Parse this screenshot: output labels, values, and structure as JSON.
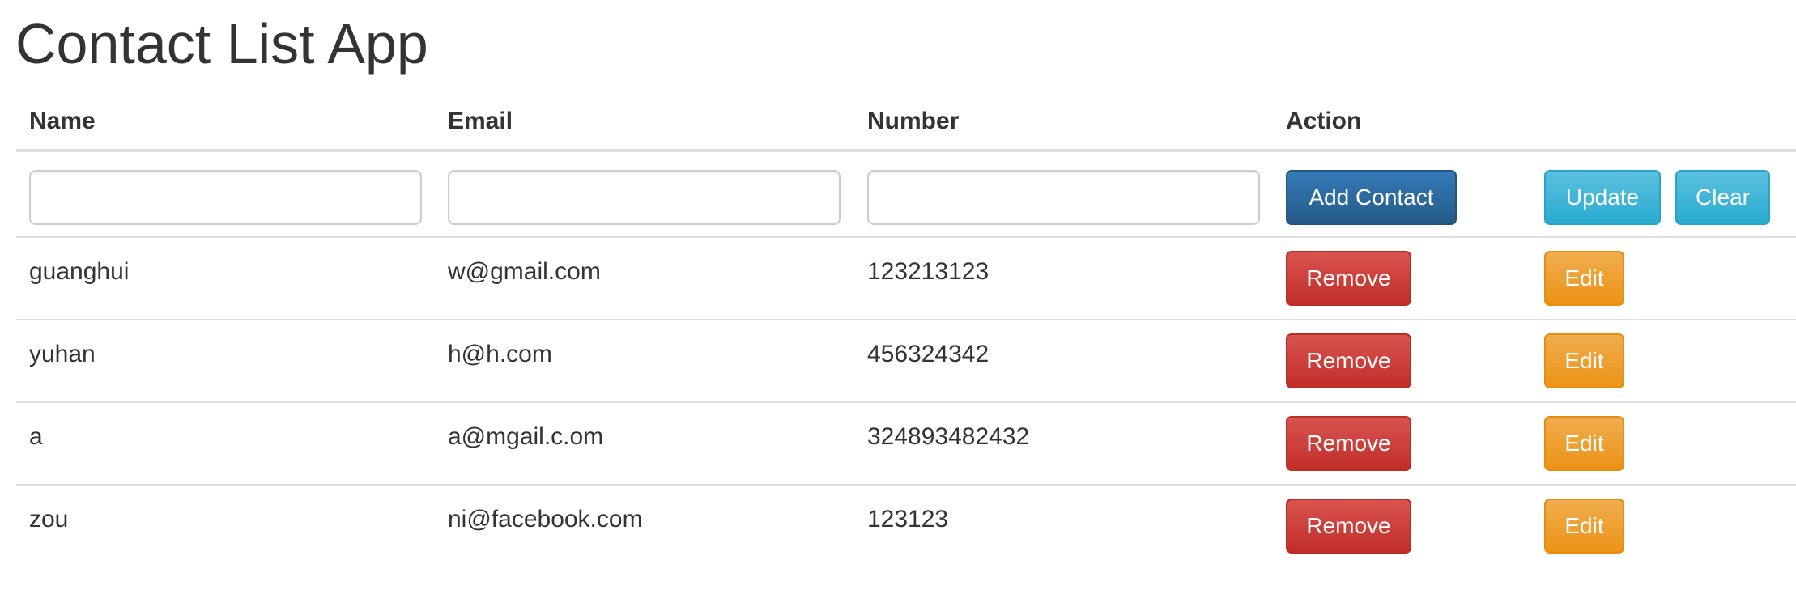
{
  "app": {
    "title": "Contact List App"
  },
  "table": {
    "headers": {
      "name": "Name",
      "email": "Email",
      "number": "Number",
      "action": "Action"
    },
    "form": {
      "name_value": "",
      "email_value": "",
      "number_value": "",
      "add_label": "Add Contact",
      "update_label": "Update",
      "clear_label": "Clear"
    },
    "contacts": [
      {
        "name": "guanghui",
        "email": "w@gmail.com",
        "number": "123213123",
        "remove_label": "Remove",
        "edit_label": "Edit"
      },
      {
        "name": "yuhan",
        "email": "h@h.com",
        "number": "456324342",
        "remove_label": "Remove",
        "edit_label": "Edit"
      },
      {
        "name": "a",
        "email": "a@mgail.c.om",
        "number": "324893482432",
        "remove_label": "Remove",
        "edit_label": "Edit"
      },
      {
        "name": "zou",
        "email": "ni@facebook.com",
        "number": "123123",
        "remove_label": "Remove",
        "edit_label": "Edit"
      }
    ]
  },
  "colors": {
    "primary": "#337ab7",
    "info": "#5bc0de",
    "danger": "#d9534f",
    "warning": "#f0ad4e",
    "text": "#333333",
    "border": "#dddddd"
  }
}
